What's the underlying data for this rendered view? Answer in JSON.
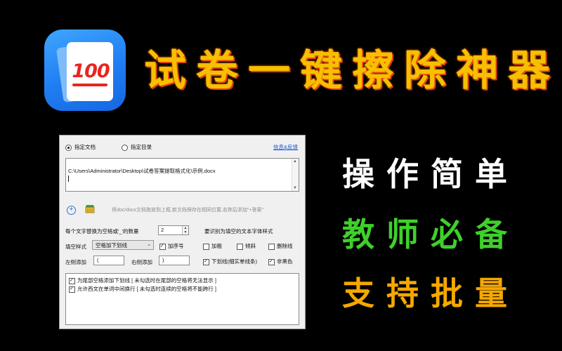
{
  "app_icon": {
    "score": "100"
  },
  "headline": [
    "试",
    "卷",
    "一",
    "键",
    "擦",
    "除",
    "神",
    "器"
  ],
  "slogans": [
    [
      "操",
      "作",
      "简",
      "单"
    ],
    [
      "教",
      "师",
      "必",
      "备"
    ],
    [
      "支",
      "持",
      "批",
      "量"
    ]
  ],
  "window": {
    "radio_file": "指定文档",
    "radio_dir": "指定目录",
    "info_link": "信息&反馈",
    "path_value": "C:\\Users\\Administrator\\Desktop\\试卷答案提取格式化\\示例.docx",
    "drop_hint": "将doc/docx文档拖放到上框,新文档保存在相同位置,名称后添加\"+答案\"",
    "char_count_label": "每个文字替换为空格或'_'的数量",
    "char_count_value": "2",
    "recognize_label": "要识别为填空的文本字体样式",
    "fill_style_label": "填空样式",
    "fill_style_value": "空格加下划线",
    "add_number_label": "加序号",
    "bold_label": "加粗",
    "italic_label": "倾斜",
    "strike_label": "删除线",
    "left_add_label": "左侧添加",
    "left_add_value": "(",
    "right_add_label": "右侧添加",
    "right_add_value": ")",
    "underline_label": "下划线(细实单线条)",
    "nonblack_label": "非黑色",
    "option1": "为尾部空格添加下划线 [ 未勾选时在尾部的空格将无法显示 ]",
    "option2": "允许西文在单词中间换行 [ 未勾选时连续的空格将不能跨行 ]"
  }
}
